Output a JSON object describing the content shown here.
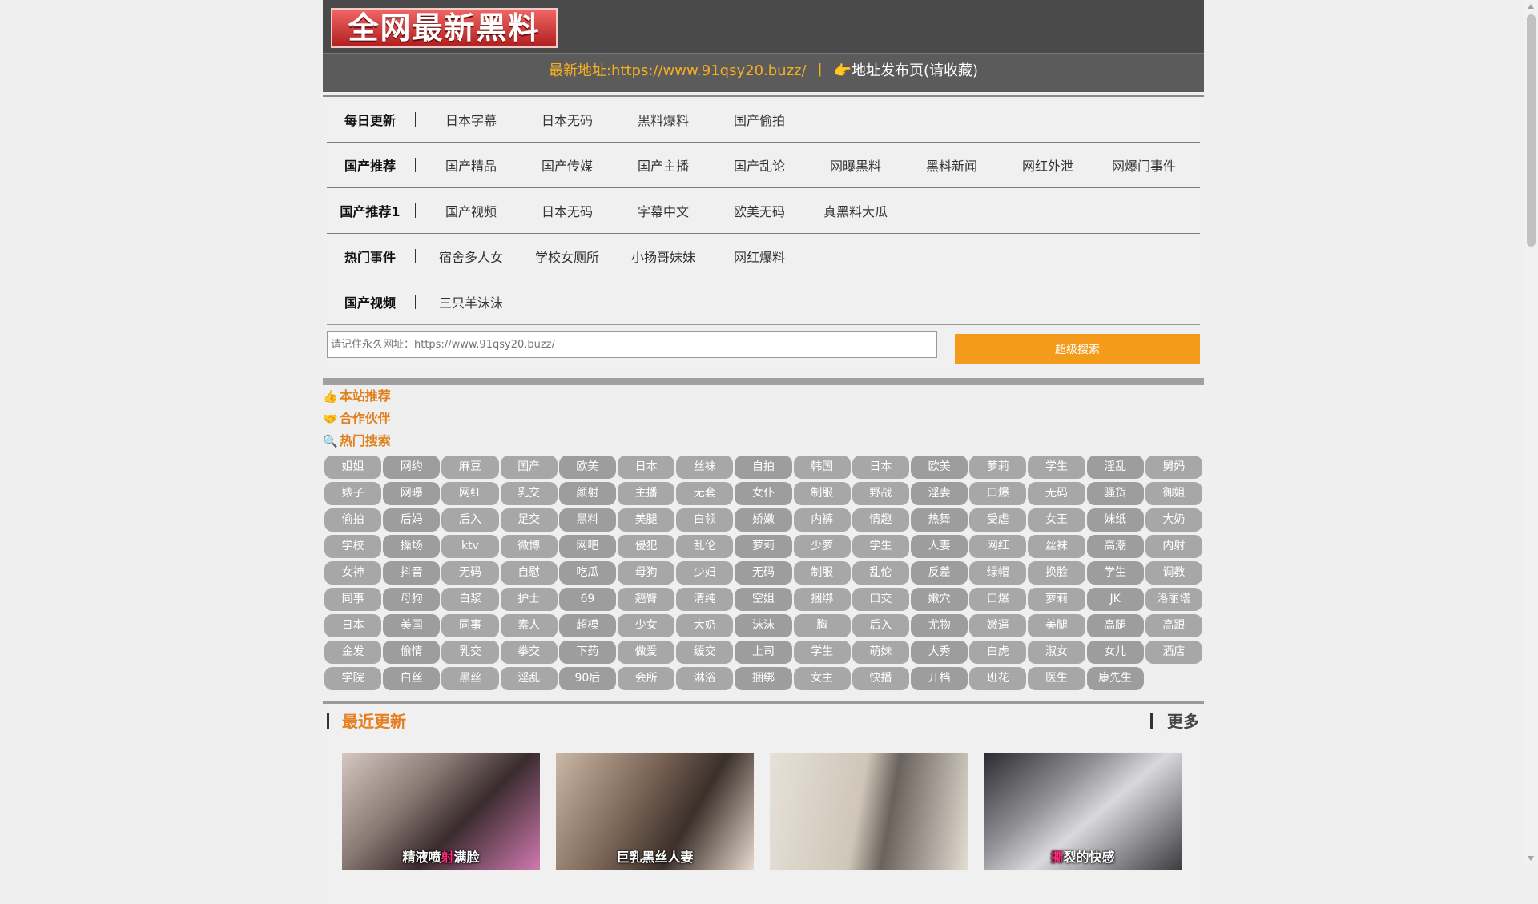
{
  "logo": {
    "text": "全网最新黑料"
  },
  "address_bar": {
    "latest_label": "最新地址:https://www.91qsy20.buzz/",
    "separator": "丨",
    "hand_icon": "👉",
    "publish_label": "地址发布页(请收藏)"
  },
  "nav": [
    {
      "head": "每日更新",
      "items": [
        "日本字幕",
        "日本无码",
        "黑料爆料",
        "国产偷拍"
      ]
    },
    {
      "head": "国产推荐",
      "items": [
        "国产精品",
        "国产传媒",
        "国产主播",
        "国产乱论",
        "网曝黑料",
        "黑料新闻",
        "网红外泄",
        "网爆门事件"
      ]
    },
    {
      "head": "国产推荐1",
      "items": [
        "国产视频",
        "日本无码",
        "字幕中文",
        "欧美无码",
        "真黑料大瓜"
      ]
    },
    {
      "head": "热门事件",
      "items": [
        "宿舍多人女",
        "学校女厕所",
        "小扬哥妹妹",
        "网红爆料"
      ]
    },
    {
      "head": "国产视频",
      "items": [
        "三只羊沫沫"
      ]
    }
  ],
  "search": {
    "placeholder": "请记住永久网址：https://www.91qsy20.buzz/",
    "button_label": "超级搜索"
  },
  "sections": {
    "recommend": {
      "icon": "👍",
      "label": "本站推荐"
    },
    "partners": {
      "icon": "🤝",
      "label": "合作伙伴"
    },
    "hot_search": {
      "icon": "🔍",
      "label": "热门搜索"
    }
  },
  "tags": [
    "姐姐",
    "网约",
    "麻豆",
    "国产",
    "欧美",
    "日本",
    "丝袜",
    "自拍",
    "韩国",
    "日本",
    "欧美",
    "萝莉",
    "学生",
    "淫乱",
    "舅妈",
    "婊子",
    "网曝",
    "网红",
    "乳交",
    "颜射",
    "主播",
    "无套",
    "女仆",
    "制服",
    "野战",
    "淫妻",
    "口爆",
    "无码",
    "骚货",
    "御姐",
    "偷拍",
    "后妈",
    "后入",
    "足交",
    "黑料",
    "美腿",
    "白领",
    "娇嫩",
    "内裤",
    "情趣",
    "热舞",
    "受虐",
    "女王",
    "妹纸",
    "大奶",
    "学校",
    "操场",
    "ktv",
    "微博",
    "网吧",
    "侵犯",
    "乱伦",
    "萝莉",
    "少萝",
    "学生",
    "人妻",
    "网红",
    "丝袜",
    "高潮",
    "内射",
    "女神",
    "抖音",
    "无码",
    "自慰",
    "吃瓜",
    "母狗",
    "少妇",
    "无码",
    "制服",
    "乱伦",
    "反差",
    "绿帽",
    "换脸",
    "学生",
    "调教",
    "同事",
    "母狗",
    "白浆",
    "护士",
    "69",
    "翘臀",
    "清纯",
    "空姐",
    "捆绑",
    "口交",
    "嫩穴",
    "口爆",
    "萝莉",
    "JK",
    "洛丽塔",
    "日本",
    "美国",
    "同事",
    "素人",
    "超模",
    "少女",
    "大奶",
    "沫沫",
    "胸",
    "后入",
    "尤物",
    "嫩逼",
    "美腿",
    "高腿",
    "高跟",
    "金发",
    "偷情",
    "乳交",
    "拳交",
    "下药",
    "做爱",
    "缓交",
    "上司",
    "学生",
    "萌妹",
    "大秀",
    "白虎",
    "淑女",
    "女儿",
    "酒店",
    "学院",
    "白丝",
    "黑丝",
    "淫乱",
    "90后",
    "会所",
    "淋浴",
    "捆绑",
    "女主",
    "快播",
    "开档",
    "班花",
    "医生",
    "康先生"
  ],
  "recent": {
    "title": "最近更新",
    "more_label": "更多",
    "items": [
      {
        "caption_a": "精液喷",
        "caption_hl": "射",
        "caption_b": "满脸"
      },
      {
        "caption_a": "巨乳黑丝人妻",
        "caption_hl": "",
        "caption_b": ""
      },
      {
        "caption_a": "",
        "caption_hl": "",
        "caption_b": ""
      },
      {
        "caption_a": "",
        "caption_hl": "撕",
        "caption_b": "裂的快感"
      }
    ]
  }
}
